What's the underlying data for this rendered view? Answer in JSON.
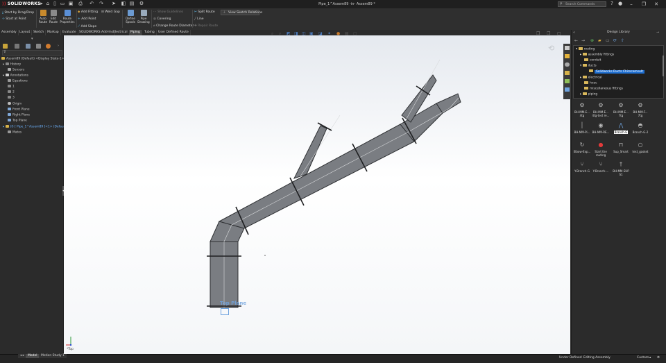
{
  "window": {
    "app_name": "SOLIDWORKS",
    "doc_title": "Pipe_1^Assem89 -in- Assem89 *",
    "search_placeholder": "Search Commands",
    "minimize": "–",
    "restore": "❐",
    "close": "✕"
  },
  "ribbon": {
    "start_drag_drop": "Start by Drag/Drop",
    "start_at_point": "Start at Point",
    "auto_route": "Auto Route",
    "edit_route": "Edit Route",
    "route_properties": "Route Properties",
    "add_fitting": "Add Fitting",
    "weld_gap": "Weld Gap",
    "add_point": "Add Point",
    "add_slope": "Add Slope",
    "define_spools": "Define Spools",
    "pipe_drawing": "Pipe Drawing",
    "show_guidelines": "Show Guidelines",
    "covering": "Covering",
    "change_route_diameter": "Change Route Diameter",
    "split_route": "Split Route",
    "line": "Line",
    "repair_route": "Repair Route",
    "view_sketch_relations": "View Sketch Relations"
  },
  "tabs": [
    {
      "label": "Assembly"
    },
    {
      "label": "Layout"
    },
    {
      "label": "Sketch"
    },
    {
      "label": "Markup"
    },
    {
      "label": "Evaluate"
    },
    {
      "label": "SOLIDWORKS Add-Ins"
    },
    {
      "label": "Electrical"
    },
    {
      "label": "Piping"
    },
    {
      "label": "Tubing"
    },
    {
      "label": "User Defined Route"
    }
  ],
  "feature_tree": {
    "root": "Assem89 (Default) <Display State-1>",
    "items": [
      {
        "label": "History"
      },
      {
        "label": "Sensors"
      },
      {
        "label": "Annotations"
      },
      {
        "label": "Equations"
      },
      {
        "label": "1"
      },
      {
        "label": "2"
      },
      {
        "label": "3"
      },
      {
        "label": "Origin"
      },
      {
        "label": "Front Plane"
      },
      {
        "label": "Right Plane"
      },
      {
        "label": "Top Plane"
      },
      {
        "label": "(f) [ Pipe_1^Assem89 ]<1> (Default)"
      },
      {
        "label": "Mates"
      }
    ]
  },
  "viewport": {
    "plane_label": "Top Plane",
    "triad_label": "*Top"
  },
  "design_library": {
    "title": "Design Library",
    "tree": [
      {
        "label": "routing"
      },
      {
        "label": "assembly fittings"
      },
      {
        "label": "conduit"
      },
      {
        "label": "ducts"
      },
      {
        "label": "Solidworks Ducts Chimcomsult"
      },
      {
        "label": "electrical"
      },
      {
        "label": "hvac"
      },
      {
        "label": "miscellaneous fittings"
      },
      {
        "label": "piping"
      }
    ],
    "items": [
      {
        "label": "BH-MM-E... 4tg"
      },
      {
        "label": "BH-MM-E... 4tg-test re..."
      },
      {
        "label": "BH-MM-E... 7tg"
      },
      {
        "label": "BH-MM-F... 7tg"
      },
      {
        "label": "BH-MM-Pi..."
      },
      {
        "label": "BH-MM-RE..."
      },
      {
        "label": "Branch-G"
      },
      {
        "label": "Branch-G-2"
      },
      {
        "label": "Elbow-Exp..."
      },
      {
        "label": "Start the routing"
      },
      {
        "label": "Sup_Smart"
      },
      {
        "label": "test_gasket"
      },
      {
        "label": "Y-Branch-G"
      },
      {
        "label": "Y-Branch-..."
      },
      {
        "label": "BH-MM-SUP S1"
      }
    ]
  },
  "status_bar": {
    "tab_model": "Model",
    "tab_motion": "Motion Study 1",
    "under_defined": "Under Defined",
    "editing": "Editing Assembly",
    "units": "Custom"
  }
}
